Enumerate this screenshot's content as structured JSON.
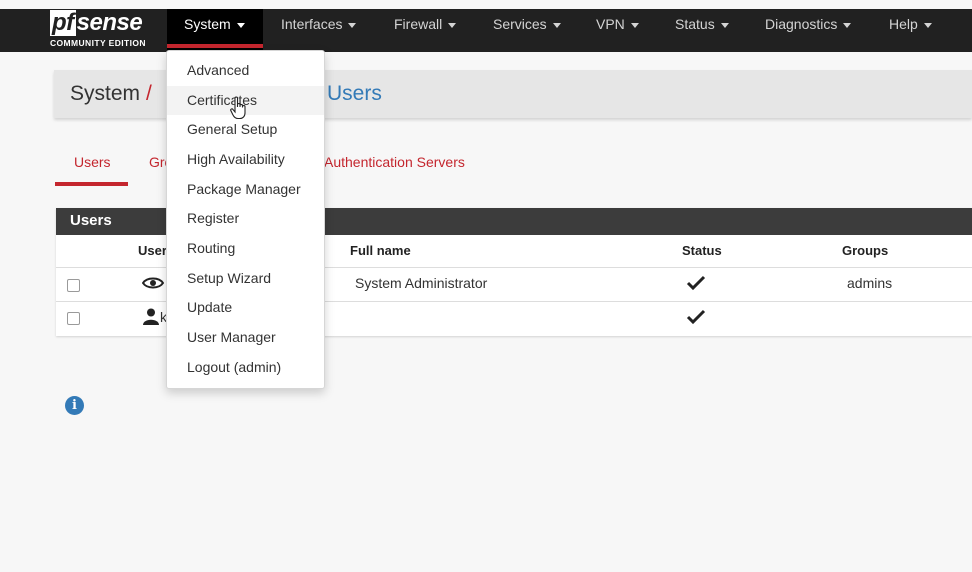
{
  "logo": {
    "word_prefix": "pf",
    "word_suffix": "sense",
    "edition": "COMMUNITY EDITION"
  },
  "nav": {
    "items": [
      {
        "label": "System",
        "active": true
      },
      {
        "label": "Interfaces"
      },
      {
        "label": "Firewall"
      },
      {
        "label": "Services"
      },
      {
        "label": "VPN"
      },
      {
        "label": "Status"
      },
      {
        "label": "Diagnostics"
      },
      {
        "label": "Help"
      }
    ]
  },
  "dropdown": {
    "items": [
      "Advanced",
      "Certificates",
      "General Setup",
      "High Availability",
      "Package Manager",
      "Register",
      "Routing",
      "Setup Wizard",
      "Update",
      "User Manager",
      "Logout (admin)"
    ],
    "hovered": "Certificates"
  },
  "breadcrumb": {
    "part1": "System",
    "separator": "/",
    "part3": "Users"
  },
  "tabs": [
    "Users",
    "Gro",
    "Authentication Servers"
  ],
  "users_panel": {
    "title": "Users",
    "columns": [
      "User",
      "Full name",
      "Status",
      "Groups"
    ],
    "rows": [
      {
        "user_icon": "eye-icon",
        "username": "",
        "full_name": "System Administrator",
        "status": "check-icon",
        "groups": "admins"
      },
      {
        "user_icon": "user-icon",
        "username": "k",
        "full_name": "",
        "status": "check-icon",
        "groups": ""
      }
    ]
  },
  "colors": {
    "navbar": "#212121",
    "accent_red": "#c4262e",
    "link_blue": "#337ab7"
  },
  "icons": {
    "info": "info-icon",
    "cursor": "hand-pointer-icon"
  }
}
